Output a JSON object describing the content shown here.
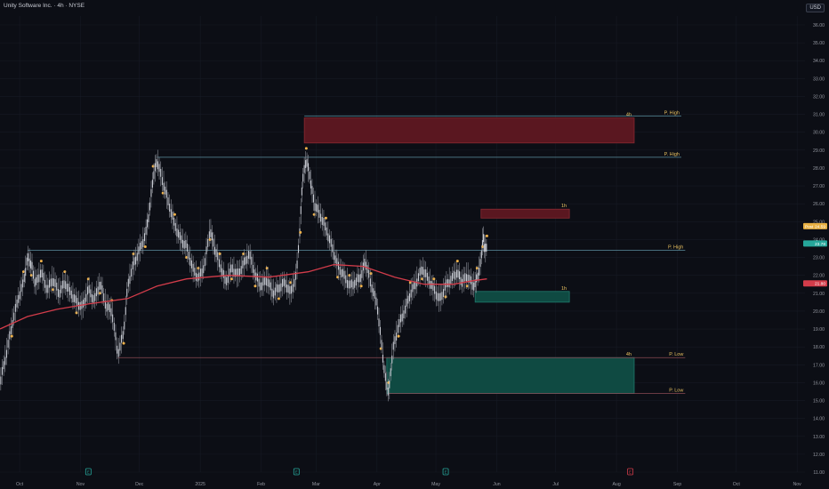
{
  "header": {
    "title": "Unity Software Inc. · 4h · NYSE",
    "currency": "USD"
  },
  "chart_data": {
    "type": "line",
    "title": "Unity Software Inc. · 4h · NYSE",
    "ylim": [
      11.0,
      36.0
    ],
    "x_range": [
      "2024-09-21",
      "2025-11-05"
    ],
    "y_ticks": [
      "11.00",
      "12.00",
      "13.00",
      "14.00",
      "15.00",
      "16.00",
      "17.00",
      "18.00",
      "19.00",
      "20.00",
      "21.00",
      "22.00",
      "23.00",
      "24.00",
      "25.00",
      "26.00",
      "27.00",
      "28.00",
      "29.00",
      "30.00",
      "31.00",
      "32.00",
      "33.00",
      "34.00",
      "35.00",
      "36.00"
    ],
    "x_ticks": [
      {
        "label": "Oct",
        "date": "2024-10-01"
      },
      {
        "label": "Nov",
        "date": "2024-11-01"
      },
      {
        "label": "Dec",
        "date": "2024-12-01"
      },
      {
        "label": "2025",
        "date": "2025-01-01"
      },
      {
        "label": "Feb",
        "date": "2025-02-01"
      },
      {
        "label": "Mar",
        "date": "2025-03-01"
      },
      {
        "label": "Apr",
        "date": "2025-04-01"
      },
      {
        "label": "May",
        "date": "2025-05-01"
      },
      {
        "label": "Jun",
        "date": "2025-06-01"
      },
      {
        "label": "Jul",
        "date": "2025-07-01"
      },
      {
        "label": "Aug",
        "date": "2025-08-01"
      },
      {
        "label": "Sep",
        "date": "2025-09-01"
      },
      {
        "label": "Oct",
        "date": "2025-10-01"
      },
      {
        "label": "Nov",
        "date": "2025-11-01"
      }
    ],
    "series": [
      {
        "type": "price",
        "color": "#b2b5be",
        "points": [
          [
            "2024-09-21",
            16.0
          ],
          [
            "2024-09-24",
            17.5
          ],
          [
            "2024-09-27",
            19.2
          ],
          [
            "2024-09-30",
            20.6
          ],
          [
            "2024-10-03",
            21.6
          ],
          [
            "2024-10-05",
            23.0
          ],
          [
            "2024-10-07",
            22.6
          ],
          [
            "2024-10-09",
            21.5
          ],
          [
            "2024-10-12",
            22.2
          ],
          [
            "2024-10-15",
            21.2
          ],
          [
            "2024-10-18",
            21.8
          ],
          [
            "2024-10-21",
            21.0
          ],
          [
            "2024-10-24",
            21.6
          ],
          [
            "2024-10-27",
            21.0
          ],
          [
            "2024-10-30",
            20.5
          ],
          [
            "2024-11-02",
            20.2
          ],
          [
            "2024-11-05",
            21.2
          ],
          [
            "2024-11-08",
            20.6
          ],
          [
            "2024-11-11",
            21.6
          ],
          [
            "2024-11-14",
            20.3
          ],
          [
            "2024-11-17",
            20.0
          ],
          [
            "2024-11-20",
            17.6
          ],
          [
            "2024-11-23",
            18.8
          ],
          [
            "2024-11-25",
            21.4
          ],
          [
            "2024-11-28",
            22.6
          ],
          [
            "2024-12-01",
            23.4
          ],
          [
            "2024-12-04",
            24.2
          ],
          [
            "2024-12-06",
            25.5
          ],
          [
            "2024-12-08",
            27.5
          ],
          [
            "2024-12-10",
            28.4
          ],
          [
            "2024-12-13",
            27.2
          ],
          [
            "2024-12-16",
            26.0
          ],
          [
            "2024-12-19",
            24.8
          ],
          [
            "2024-12-22",
            24.0
          ],
          [
            "2024-12-25",
            23.6
          ],
          [
            "2024-12-28",
            22.4
          ],
          [
            "2024-12-31",
            21.8
          ],
          [
            "2025-01-03",
            22.5
          ],
          [
            "2025-01-06",
            24.6
          ],
          [
            "2025-01-08",
            23.6
          ],
          [
            "2025-01-11",
            22.6
          ],
          [
            "2025-01-14",
            21.6
          ],
          [
            "2025-01-17",
            22.4
          ],
          [
            "2025-01-20",
            22.0
          ],
          [
            "2025-01-23",
            22.6
          ],
          [
            "2025-01-26",
            23.2
          ],
          [
            "2025-01-29",
            22.0
          ],
          [
            "2025-02-01",
            21.4
          ],
          [
            "2025-02-04",
            21.8
          ],
          [
            "2025-02-07",
            21.0
          ],
          [
            "2025-02-10",
            21.3
          ],
          [
            "2025-02-13",
            21.6
          ],
          [
            "2025-02-16",
            21.0
          ],
          [
            "2025-02-19",
            22.0
          ],
          [
            "2025-02-21",
            25.0
          ],
          [
            "2025-02-22",
            27.2
          ],
          [
            "2025-02-24",
            28.5
          ],
          [
            "2025-02-26",
            27.4
          ],
          [
            "2025-02-28",
            26.0
          ],
          [
            "2025-03-03",
            25.4
          ],
          [
            "2025-03-06",
            24.6
          ],
          [
            "2025-03-09",
            23.6
          ],
          [
            "2025-03-12",
            22.5
          ],
          [
            "2025-03-15",
            22.0
          ],
          [
            "2025-03-18",
            21.4
          ],
          [
            "2025-03-21",
            21.6
          ],
          [
            "2025-03-24",
            22.0
          ],
          [
            "2025-03-26",
            22.8
          ],
          [
            "2025-03-29",
            21.5
          ],
          [
            "2025-04-01",
            20.4
          ],
          [
            "2025-04-03",
            18.5
          ],
          [
            "2025-04-05",
            16.4
          ],
          [
            "2025-04-07",
            15.4
          ],
          [
            "2025-04-09",
            17.8
          ],
          [
            "2025-04-12",
            19.2
          ],
          [
            "2025-04-15",
            20.0
          ],
          [
            "2025-04-18",
            21.0
          ],
          [
            "2025-04-21",
            21.6
          ],
          [
            "2025-04-24",
            22.4
          ],
          [
            "2025-04-27",
            21.8
          ],
          [
            "2025-04-30",
            21.2
          ],
          [
            "2025-05-03",
            20.6
          ],
          [
            "2025-05-06",
            21.4
          ],
          [
            "2025-05-09",
            21.8
          ],
          [
            "2025-05-12",
            22.2
          ],
          [
            "2025-05-14",
            21.6
          ],
          [
            "2025-05-17",
            22.0
          ],
          [
            "2025-05-20",
            21.4
          ],
          [
            "2025-05-22",
            21.8
          ],
          [
            "2025-05-24",
            22.8
          ],
          [
            "2025-05-25",
            24.2
          ],
          [
            "2025-05-26",
            23.4
          ],
          [
            "2025-05-27",
            23.6
          ]
        ]
      },
      {
        "type": "moving-average",
        "color": "#d23c4a",
        "points": [
          [
            "2024-09-21",
            19.0
          ],
          [
            "2024-10-05",
            19.7
          ],
          [
            "2024-10-20",
            20.1
          ],
          [
            "2024-11-05",
            20.4
          ],
          [
            "2024-11-25",
            20.7
          ],
          [
            "2024-12-10",
            21.4
          ],
          [
            "2024-12-25",
            21.8
          ],
          [
            "2025-01-15",
            22.0
          ],
          [
            "2025-02-05",
            21.9
          ],
          [
            "2025-02-25",
            22.2
          ],
          [
            "2025-03-10",
            22.6
          ],
          [
            "2025-03-25",
            22.5
          ],
          [
            "2025-04-10",
            21.9
          ],
          [
            "2025-04-25",
            21.5
          ],
          [
            "2025-05-10",
            21.5
          ],
          [
            "2025-05-20",
            21.7
          ],
          [
            "2025-05-27",
            21.8
          ]
        ]
      }
    ],
    "zones": [
      {
        "name": "supply-4h",
        "label": "4h",
        "from": "2025-02-23",
        "to": "2025-08-10",
        "low": 29.4,
        "high": 30.8,
        "fill": "#5a1720",
        "border": "#8a2a32"
      },
      {
        "name": "supply-1h",
        "label": "1h",
        "from": "2025-05-24",
        "to": "2025-07-08",
        "low": 25.2,
        "high": 25.7,
        "fill": "#5a1720",
        "border": "#8a2a32"
      },
      {
        "name": "demand-1h",
        "label": "1h",
        "from": "2025-05-21",
        "to": "2025-07-08",
        "low": 20.5,
        "high": 21.1,
        "fill": "#0f4a42",
        "border": "#1f7a6c"
      },
      {
        "name": "demand-4h",
        "label": "4h",
        "from": "2025-04-06",
        "to": "2025-08-10",
        "low": 15.4,
        "high": 17.4,
        "fill": "#0f4a42",
        "border": "#1f7a6c"
      }
    ],
    "levels": [
      {
        "label": "P. High",
        "value": 30.9,
        "from": "2025-02-23",
        "to": "2025-09-03",
        "color": "#5b8fa0"
      },
      {
        "label": "P. High",
        "value": 28.6,
        "from": "2024-12-10",
        "to": "2025-09-03",
        "color": "#5b8fa0"
      },
      {
        "label": "P. High",
        "value": 23.4,
        "from": "2024-10-05",
        "to": "2025-09-05",
        "color": "#5b8fa0"
      },
      {
        "label": "P. Low",
        "value": 17.4,
        "from": "2024-11-20",
        "to": "2025-09-05",
        "color": "#8a4a55"
      },
      {
        "label": "P. Low",
        "value": 15.4,
        "from": "2025-04-07",
        "to": "2025-09-05",
        "color": "#8a4a55"
      }
    ],
    "price_badges": [
      {
        "label": "Post",
        "text": "24.59",
        "value": 24.75,
        "color": "#e8b042"
      },
      {
        "label": "",
        "text": "23.78",
        "value": 23.78,
        "color": "#26a69a"
      },
      {
        "label": "",
        "text": "21.80",
        "value": 21.55,
        "color": "#d23c4a"
      }
    ],
    "event_markers": [
      {
        "date": "2024-11-05",
        "color": "#26a69a",
        "text": "E"
      },
      {
        "date": "2025-02-19",
        "color": "#26a69a",
        "text": "E"
      },
      {
        "date": "2025-05-06",
        "color": "#26a69a",
        "text": "E"
      },
      {
        "date": "2025-08-08",
        "color": "#d23c4a",
        "text": "E"
      }
    ]
  }
}
